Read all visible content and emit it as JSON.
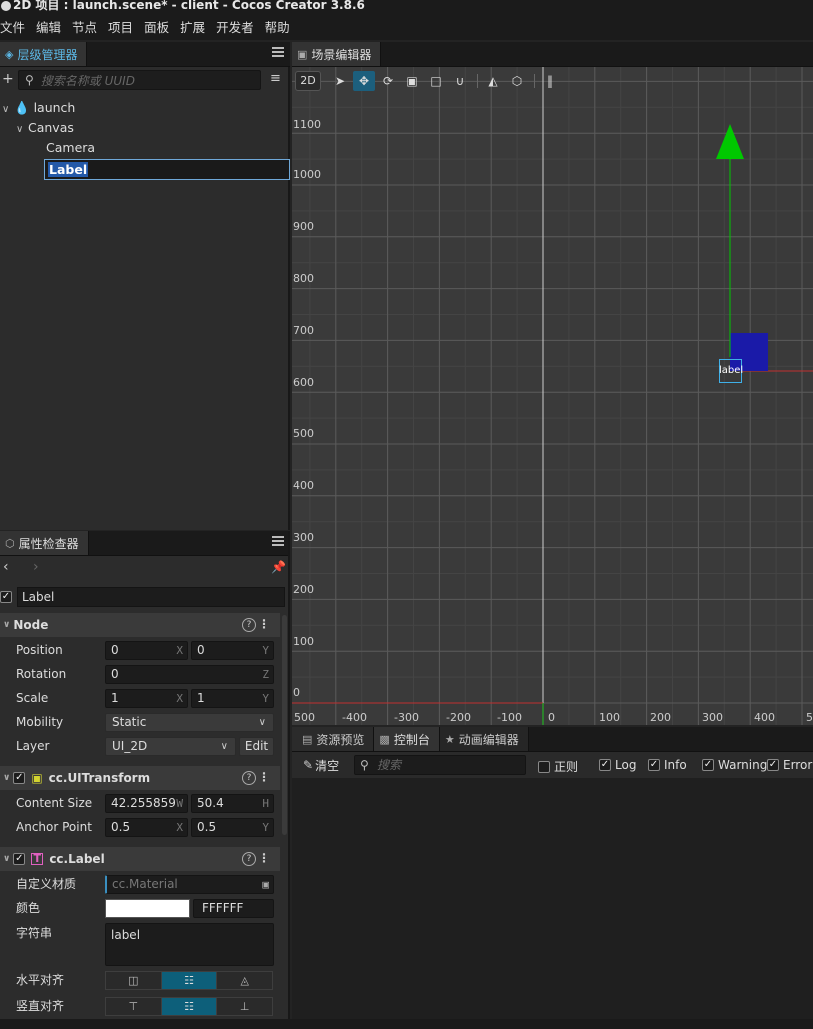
{
  "window": {
    "title": "2D 项目 : launch.scene* - client - Cocos Creator 3.8.6"
  },
  "menu": [
    "文件",
    "编辑",
    "节点",
    "项目",
    "面板",
    "扩展",
    "开发者",
    "帮助"
  ],
  "hierarchy": {
    "tab": "层级管理器",
    "search_placeholder": "搜索名称或 UUID",
    "nodes": {
      "launch": "launch",
      "canvas": "Canvas",
      "camera": "Camera",
      "label": "Label"
    }
  },
  "inspector": {
    "tab": "属性检查器",
    "node_name": "Label",
    "node": {
      "title": "Node",
      "position_label": "Position",
      "position_x": "0",
      "position_y": "0",
      "rotation_label": "Rotation",
      "rotation_z": "0",
      "scale_label": "Scale",
      "scale_x": "1",
      "scale_y": "1",
      "mobility_label": "Mobility",
      "mobility_value": "Static",
      "layer_label": "Layer",
      "layer_value": "UI_2D",
      "edit_label": "Edit"
    },
    "uitransform": {
      "title": "cc.UITransform",
      "content_size_label": "Content Size",
      "width": "42.255859",
      "height": "50.4",
      "anchor_label": "Anchor Point",
      "anchor_x": "0.5",
      "anchor_y": "0.5"
    },
    "label": {
      "title": "cc.Label",
      "material_label": "自定义材质",
      "material_value": "cc.Material",
      "color_label": "颜色",
      "color_hex": "FFFFFF",
      "string_label": "字符串",
      "string_value": "label",
      "halign_label": "水平对齐",
      "valign_label": "竖直对齐"
    },
    "axes": {
      "x": "X",
      "y": "Y",
      "z": "Z",
      "w": "W",
      "h": "H"
    }
  },
  "scene": {
    "tab": "场景编辑器",
    "mode": "2D",
    "y_ticks": [
      "1100",
      "1000",
      "900",
      "800",
      "700",
      "600",
      "500",
      "400",
      "300",
      "200",
      "100",
      "0"
    ],
    "x_ticks": [
      "500",
      "-400",
      "-300",
      "-200",
      "-100",
      "0",
      "100",
      "200",
      "300",
      "400",
      "5"
    ],
    "label_text": "label"
  },
  "console": {
    "tabs": {
      "assets": "资源预览",
      "console": "控制台",
      "animation": "动画编辑器"
    },
    "clear": "清空",
    "search_placeholder": "搜索",
    "filters": {
      "regex": "正则",
      "log": "Log",
      "info": "Info",
      "warning": "Warning",
      "error": "Error"
    }
  },
  "colors": {
    "accent": "#5cb8e6",
    "selected": "#2459a8",
    "gizmo_green": "#00c800",
    "sprite_blue": "#1a1aa8"
  }
}
